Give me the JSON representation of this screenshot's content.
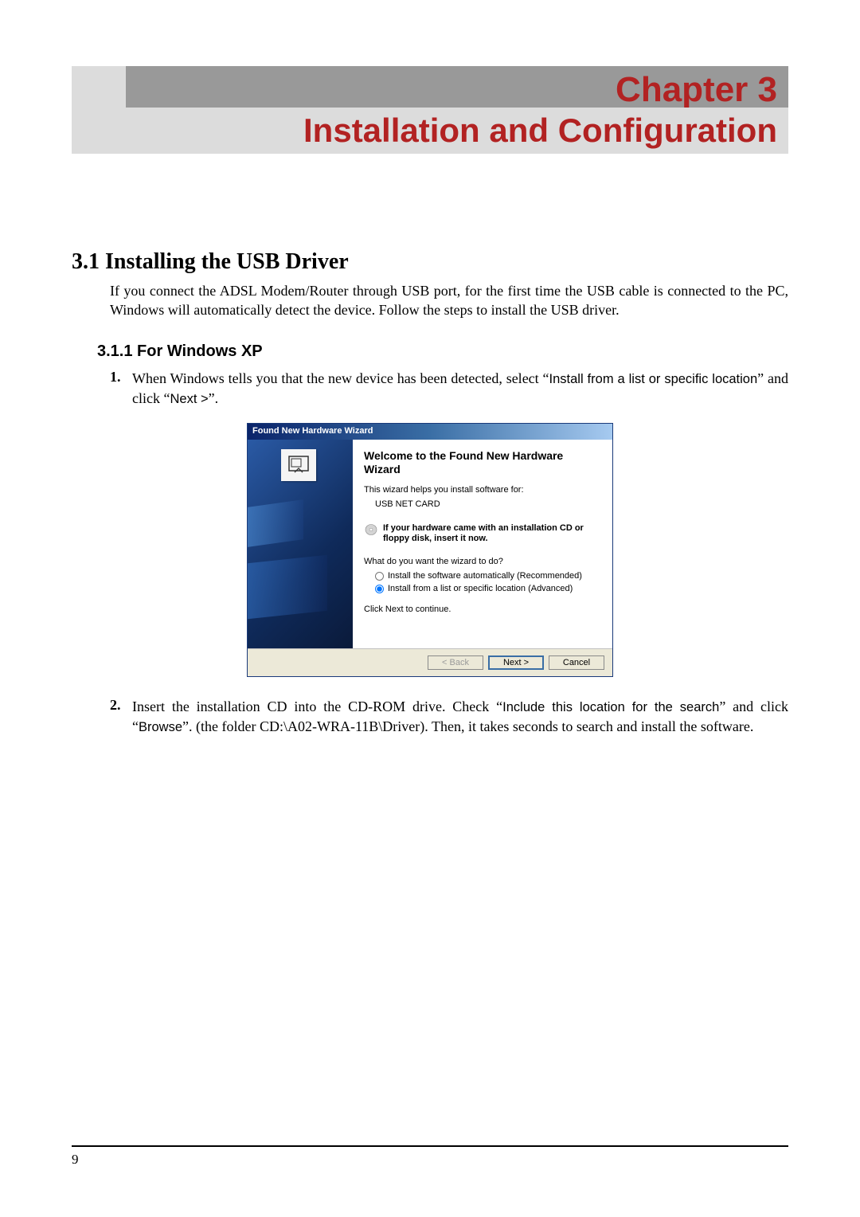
{
  "chapter": {
    "label": "Chapter 3",
    "title": "Installation and Configuration"
  },
  "section_3_1": {
    "heading": "3.1 Installing the USB Driver",
    "intro": "If you connect the ADSL Modem/Router through USB port, for the first time the USB cable is connected to the PC, Windows will automatically detect the device. Follow the steps to install the USB driver."
  },
  "section_3_1_1": {
    "heading": "3.1.1 For Windows XP",
    "steps": [
      {
        "num": "1.",
        "pre": "When Windows tells you that the new device has been detected, select “",
        "sans1": "Install from a list or specific location",
        "mid1": "” and click “",
        "sans2": "Next >",
        "post": "”."
      },
      {
        "num": "2.",
        "pre": "Insert the installation CD into the CD-ROM drive. Check “",
        "sans1": "Include this location for the search",
        "mid1": "” and click “",
        "sans2": "Browse",
        "post": "”. (the folder CD:\\A02-WRA-11B\\Driver). Then, it takes seconds to search and install the software."
      }
    ]
  },
  "wizard": {
    "title": "Found New Hardware Wizard",
    "heading": "Welcome to the Found New Hardware Wizard",
    "p1": "This wizard helps you install software for:",
    "device": "USB NET CARD",
    "note": "If your hardware came with an installation CD or floppy disk, insert it now.",
    "question": "What do you want the wizard to do?",
    "option1": "Install the software automatically (Recommended)",
    "option2": "Install from a list or specific location (Advanced)",
    "click_next": "Click Next to continue.",
    "btn_back": "< Back",
    "btn_next": "Next >",
    "btn_cancel": "Cancel",
    "selected": "list"
  },
  "page_number": "9"
}
